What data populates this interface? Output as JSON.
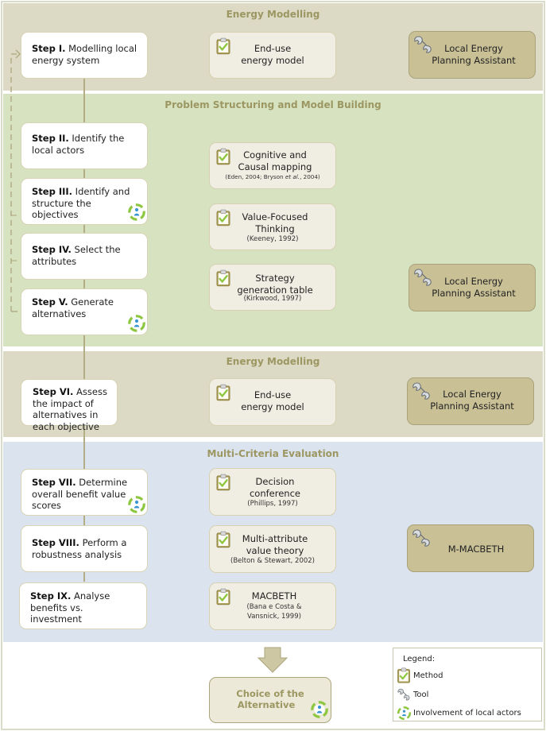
{
  "bands": [
    {
      "id": "energy-modelling-1",
      "title": "Energy Modelling",
      "color": "#dcd9c4"
    },
    {
      "id": "problem-structuring",
      "title": "Problem Structuring and Model Building",
      "color": "#d7e3c0"
    },
    {
      "id": "energy-modelling-2",
      "title": "Energy Modelling",
      "color": "#dcd9c4"
    },
    {
      "id": "multi-criteria",
      "title": "Multi-Criteria Evaluation",
      "color": "#dbe3ee"
    }
  ],
  "steps": [
    {
      "num": "Step I.",
      "text": " Modelling local energy system",
      "actors": false
    },
    {
      "num": "Step II.",
      "text": " Identify the local actors",
      "actors": false
    },
    {
      "num": "Step III.",
      "text": " Identify and structure the objectives",
      "actors": true
    },
    {
      "num": "Step IV.",
      "text": " Select the attributes",
      "actors": false
    },
    {
      "num": "Step V.",
      "text": " Generate alternatives",
      "actors": true
    },
    {
      "num": "Step VI.",
      "text": " Assess the impact of alternatives in each objective",
      "actors": false
    },
    {
      "num": "Step VII.",
      "text": " Determine overall benefit value scores",
      "actors": true
    },
    {
      "num": "Step VIII.",
      "text": " Perform a robustness analysis",
      "actors": false
    },
    {
      "num": "Step IX.",
      "text": " Analyse benefits vs. investment",
      "actors": false
    }
  ],
  "methods": [
    {
      "line1": "End-use",
      "line2": "energy model",
      "ref": ""
    },
    {
      "line1": "Cognitive and",
      "line2": "Causal mapping",
      "ref_pre": "(Eden, 2004; Bryson ",
      "ref_italic": "et al.",
      "ref_post": ", 2004)"
    },
    {
      "line1": "Value-Focused",
      "line2": "Thinking",
      "ref": "(Keeney, 1992)"
    },
    {
      "line1": "Strategy",
      "line2": "generation table",
      "ref": "(Kirkwood, 1997)"
    },
    {
      "line1": "End-use",
      "line2": "energy model",
      "ref": ""
    },
    {
      "line1": "Decision",
      "line2": "conference",
      "ref": "(Phillips, 1997)"
    },
    {
      "line1": "Multi-attribute",
      "line2": "value theory",
      "ref": "(Belton & Stewart, 2002)"
    },
    {
      "line1": "MACBETH",
      "line2": "",
      "ref": "(Bana e Costa &",
      "ref2": "Vansnick, 1999)"
    }
  ],
  "tools": [
    {
      "line1": "Local Energy",
      "line2": "Planning Assistant"
    },
    {
      "line1": "Local Energy",
      "line2": "Planning Assistant"
    },
    {
      "line1": "Local Energy",
      "line2": "Planning Assistant"
    },
    {
      "line1": "M-MACBETH",
      "line2": ""
    }
  ],
  "choice": {
    "line1": "Choice of the",
    "line2": "Alternative"
  },
  "legend": {
    "title": "Legend:",
    "items": [
      {
        "icon": "clipboard-check-icon",
        "label": "Method"
      },
      {
        "icon": "wrench-icon",
        "label": "Tool"
      },
      {
        "icon": "actors-cycle-icon",
        "label": "Involvement of local actors"
      }
    ]
  },
  "colors": {
    "band_title": "#9c9762",
    "tool_fill": "#c9c096",
    "method_fill": "#f0ede2",
    "connector": "#b3ad86"
  }
}
